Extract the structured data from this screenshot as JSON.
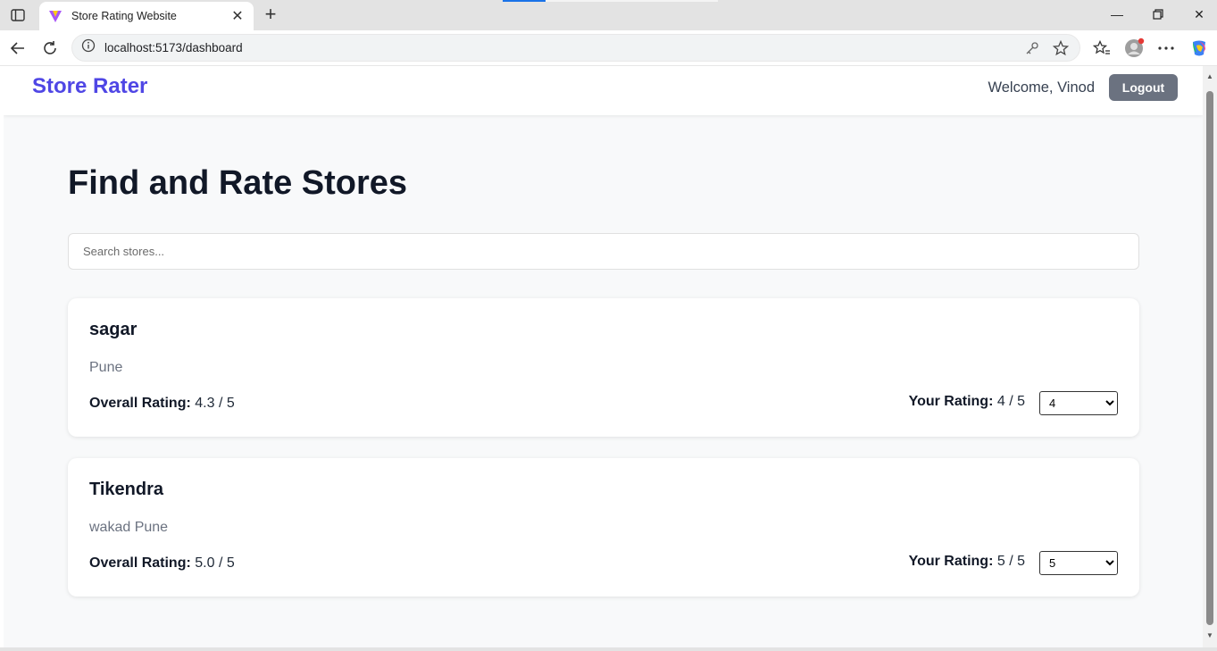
{
  "browser": {
    "tab_title": "Store Rating Website",
    "url": "localhost:5173/dashboard"
  },
  "app": {
    "brand": "Store Rater",
    "welcome": "Welcome, Vinod",
    "logout_label": "Logout",
    "brand_color": "#4f46e5"
  },
  "main": {
    "title": "Find and Rate Stores",
    "search_placeholder": "Search stores..."
  },
  "stores": [
    {
      "name": "sagar",
      "address": "Pune",
      "overall_label": "Overall Rating:",
      "overall_value": "4.3 / 5",
      "your_label": "Your Rating:",
      "your_value": "4 / 5",
      "selected": "4"
    },
    {
      "name": "Tikendra",
      "address": "wakad Pune",
      "overall_label": "Overall Rating:",
      "overall_value": "5.0 / 5",
      "your_label": "Your Rating:",
      "your_value": "5 / 5",
      "selected": "5"
    }
  ]
}
